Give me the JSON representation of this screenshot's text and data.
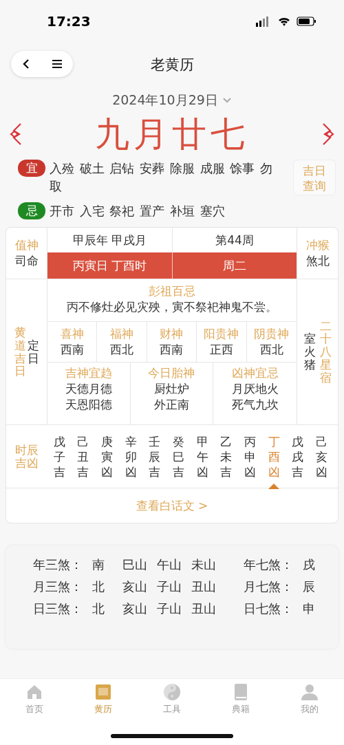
{
  "status_bar": {
    "time": "17:23"
  },
  "header": {
    "title": "老黄历"
  },
  "date": {
    "text": "2024年10月29日"
  },
  "lunar_day": "九月廿七",
  "yi": {
    "badge": "宜",
    "items": [
      "入殓",
      "破土",
      "启钻",
      "安葬",
      "除服",
      "成服",
      "馀事",
      "勿取"
    ]
  },
  "ji": {
    "badge": "忌",
    "items": [
      "开市",
      "入宅",
      "祭祀",
      "置产",
      "补垣",
      "塞穴"
    ]
  },
  "lucky_day_button": "吉日查询",
  "table": {
    "zhi_shen": {
      "label": "值神",
      "value": "司命"
    },
    "year_month": "甲辰年 甲戌月",
    "week": "第44周",
    "day_hour": "丙寅日 丁酉时",
    "weekday": "周二",
    "chong": {
      "label": "冲猴",
      "value": "煞北"
    },
    "huangdao": {
      "label": "黄道吉日",
      "value": "定日"
    },
    "pengzu": {
      "title": "彭祖百忌",
      "text": "丙不修灶必见灾殃，寅不祭祀神鬼不尝。"
    },
    "gods": [
      {
        "label": "喜神",
        "value": "西南"
      },
      {
        "label": "福神",
        "value": "西北"
      },
      {
        "label": "财神",
        "value": "西南"
      },
      {
        "label": "阳贵神",
        "value": "正西"
      },
      {
        "label": "阴贵神",
        "value": "西北"
      }
    ],
    "boxes": [
      {
        "title": "吉神宜趋",
        "lines": [
          "天德月德",
          "天恩阳德"
        ]
      },
      {
        "title": "今日胎神",
        "lines": [
          "厨灶炉",
          "外正南"
        ]
      },
      {
        "title": "凶神宜忌",
        "lines": [
          "月厌地火",
          "死气九坎"
        ]
      }
    ],
    "star": {
      "label": "二十八星宿",
      "value": "室火猪"
    },
    "hours": {
      "label": "时辰吉凶",
      "items": [
        {
          "stem": "戊",
          "branch": "子",
          "luck": "吉",
          "selected": false
        },
        {
          "stem": "己",
          "branch": "丑",
          "luck": "吉",
          "selected": false
        },
        {
          "stem": "庚",
          "branch": "寅",
          "luck": "凶",
          "selected": false
        },
        {
          "stem": "辛",
          "branch": "卯",
          "luck": "凶",
          "selected": false
        },
        {
          "stem": "壬",
          "branch": "辰",
          "luck": "吉",
          "selected": false
        },
        {
          "stem": "癸",
          "branch": "巳",
          "luck": "吉",
          "selected": false
        },
        {
          "stem": "甲",
          "branch": "午",
          "luck": "凶",
          "selected": false
        },
        {
          "stem": "乙",
          "branch": "未",
          "luck": "吉",
          "selected": false
        },
        {
          "stem": "丙",
          "branch": "申",
          "luck": "凶",
          "selected": false
        },
        {
          "stem": "丁",
          "branch": "酉",
          "luck": "凶",
          "selected": true
        },
        {
          "stem": "戊",
          "branch": "戌",
          "luck": "吉",
          "selected": false
        },
        {
          "stem": "己",
          "branch": "亥",
          "luck": "凶",
          "selected": false
        }
      ]
    },
    "link": "查看白话文 >"
  },
  "sha": [
    {
      "label": "年三煞：",
      "values": [
        "南",
        "巳山",
        "午山",
        "未山"
      ],
      "seven_label": "年七煞：",
      "seven_value": "戌"
    },
    {
      "label": "月三煞：",
      "values": [
        "北",
        "亥山",
        "子山",
        "丑山"
      ],
      "seven_label": "月七煞：",
      "seven_value": "辰"
    },
    {
      "label": "日三煞：",
      "values": [
        "北",
        "亥山",
        "子山",
        "丑山"
      ],
      "seven_label": "日七煞：",
      "seven_value": "申"
    }
  ],
  "tabs": [
    {
      "label": "首页",
      "selected": false
    },
    {
      "label": "黄历",
      "selected": true
    },
    {
      "label": "工具",
      "selected": false
    },
    {
      "label": "典籍",
      "selected": false
    },
    {
      "label": "我的",
      "selected": false
    }
  ]
}
